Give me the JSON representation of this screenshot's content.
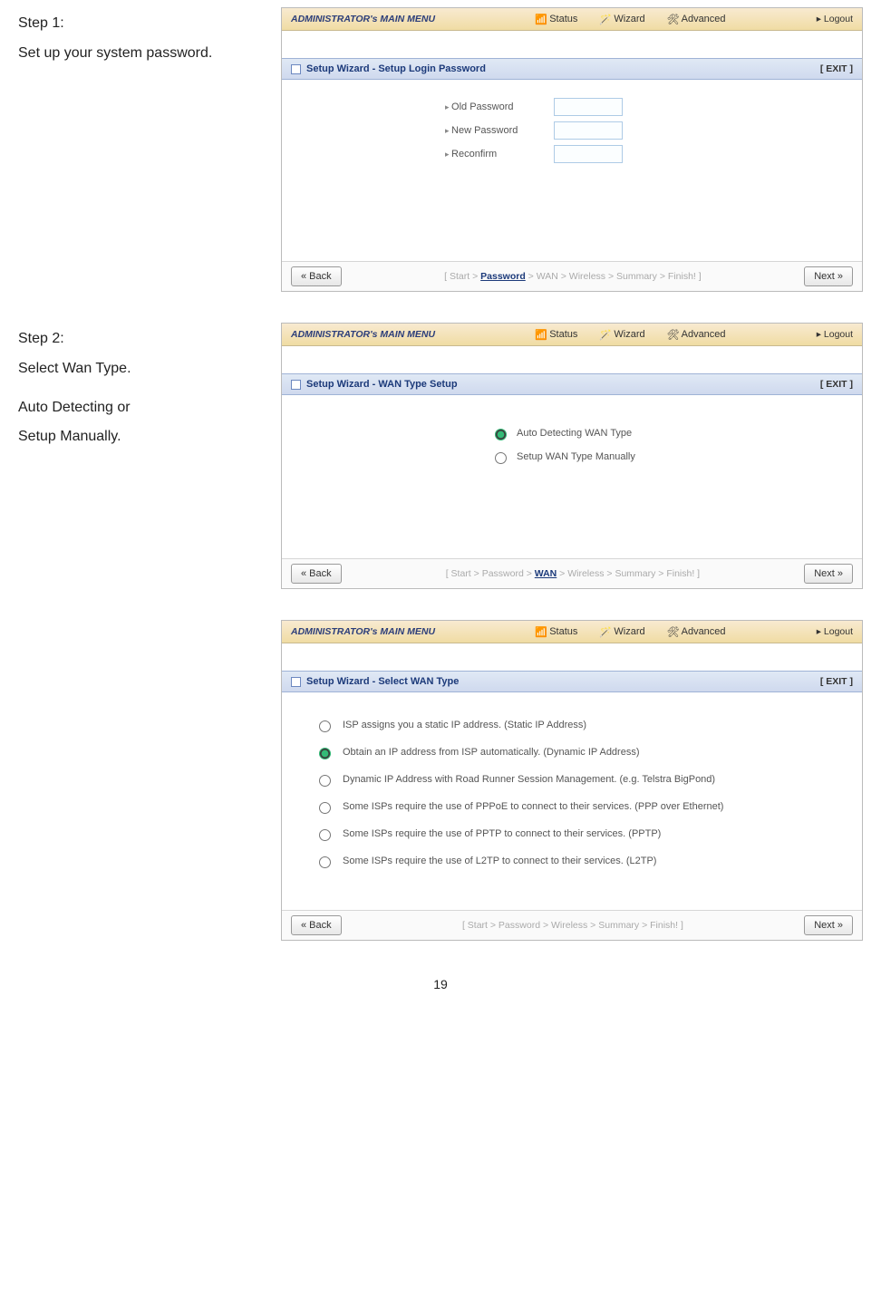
{
  "left": {
    "step1_title": "Step 1:",
    "step1_text": "Set up your system password.",
    "step2_title": "Step 2:",
    "step2_text": "Select Wan Type.",
    "step2_aux1": "Auto Detecting or",
    "step2_aux2": "Setup Manually."
  },
  "nav": {
    "brand": "ADMINISTRATOR's MAIN MENU",
    "status": "Status",
    "wizard": "Wizard",
    "advanced": "Advanced",
    "logout": "▸ Logout"
  },
  "panel1": {
    "title": "Setup Wizard - Setup Login Password",
    "exit": "[ EXIT ]",
    "old": "Old Password",
    "new": "New Password",
    "rec": "Reconfirm",
    "back": "« Back",
    "next": "Next »",
    "crumbs_pre": "[ Start > ",
    "crumbs_cur": "Password",
    "crumbs_post": " > WAN > Wireless > Summary > Finish! ]"
  },
  "panel2": {
    "title": "Setup Wizard - WAN Type Setup",
    "exit": "[ EXIT ]",
    "r1": "Auto Detecting WAN Type",
    "r2": "Setup WAN Type Manually",
    "back": "« Back",
    "next": "Next »",
    "crumbs_pre": "[ Start > Password > ",
    "crumbs_cur": "WAN",
    "crumbs_post": " > Wireless > Summary > Finish! ]"
  },
  "panel3": {
    "title": "Setup Wizard - Select WAN Type",
    "exit": "[ EXIT ]",
    "o1": "ISP assigns you a static IP address. (Static IP Address)",
    "o2": "Obtain an IP address from ISP automatically. (Dynamic IP Address)",
    "o3": "Dynamic IP Address with Road Runner Session Management. (e.g. Telstra BigPond)",
    "o4": "Some ISPs require the use of PPPoE to connect to their services. (PPP over Ethernet)",
    "o5": "Some ISPs require the use of PPTP to connect to their services. (PPTP)",
    "o6": "Some ISPs require the use of L2TP to connect to their services. (L2TP)",
    "back": "« Back",
    "next": "Next »",
    "crumbs_pre": "[ Start > Password >",
    "crumbs_mid": "          ",
    "crumbs_post": "Wireless > Summary > Finish! ]"
  },
  "page_number": "19"
}
